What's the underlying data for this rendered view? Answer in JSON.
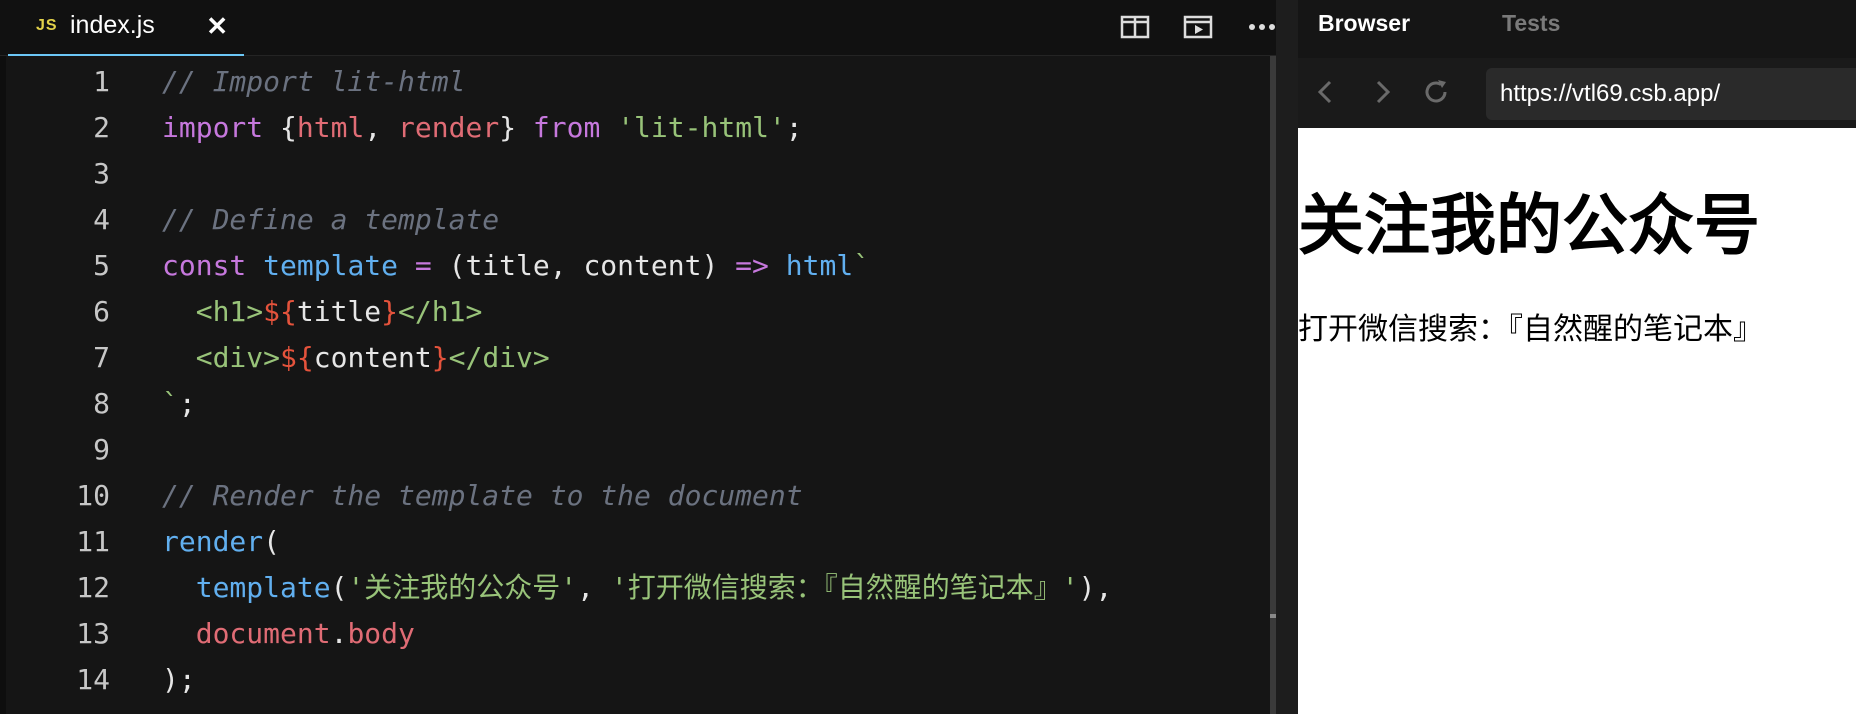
{
  "editor": {
    "tab": {
      "icon": "JS",
      "label": "index.js",
      "close_icon": "close-icon"
    },
    "toolbar_icons": [
      "split-view-icon",
      "preview-icon",
      "more-icon"
    ],
    "lines": [
      {
        "no": "1",
        "tokens": [
          {
            "t": "// Import lit-html",
            "c": "cm"
          }
        ]
      },
      {
        "no": "2",
        "tokens": [
          {
            "t": "import",
            "c": "kw"
          },
          {
            "t": " {",
            "c": "plain"
          },
          {
            "t": "html",
            "c": "id-red"
          },
          {
            "t": ", ",
            "c": "plain"
          },
          {
            "t": "render",
            "c": "id-red"
          },
          {
            "t": "} ",
            "c": "plain"
          },
          {
            "t": "from",
            "c": "kw"
          },
          {
            "t": " ",
            "c": "plain"
          },
          {
            "t": "'lit-html'",
            "c": "str"
          },
          {
            "t": ";",
            "c": "plain"
          }
        ]
      },
      {
        "no": "3",
        "tokens": []
      },
      {
        "no": "4",
        "tokens": [
          {
            "t": "// Define a template",
            "c": "cm"
          }
        ]
      },
      {
        "no": "5",
        "tokens": [
          {
            "t": "const",
            "c": "kw"
          },
          {
            "t": " ",
            "c": "plain"
          },
          {
            "t": "template",
            "c": "fn"
          },
          {
            "t": " = ",
            "c": "kw"
          },
          {
            "t": "(title, content) ",
            "c": "plain"
          },
          {
            "t": "=>",
            "c": "kw"
          },
          {
            "t": " ",
            "c": "plain"
          },
          {
            "t": "html",
            "c": "fn"
          },
          {
            "t": "`",
            "c": "str"
          }
        ]
      },
      {
        "no": "6",
        "tokens": [
          {
            "t": "  <h1>",
            "c": "str"
          },
          {
            "t": "${",
            "c": "tpl"
          },
          {
            "t": "title",
            "c": "plain"
          },
          {
            "t": "}",
            "c": "tpl"
          },
          {
            "t": "</h1>",
            "c": "str"
          }
        ]
      },
      {
        "no": "7",
        "tokens": [
          {
            "t": "  <div>",
            "c": "str"
          },
          {
            "t": "${",
            "c": "tpl"
          },
          {
            "t": "content",
            "c": "plain"
          },
          {
            "t": "}",
            "c": "tpl"
          },
          {
            "t": "</div>",
            "c": "str"
          }
        ]
      },
      {
        "no": "8",
        "tokens": [
          {
            "t": "`",
            "c": "str"
          },
          {
            "t": ";",
            "c": "plain"
          }
        ]
      },
      {
        "no": "9",
        "tokens": []
      },
      {
        "no": "10",
        "tokens": [
          {
            "t": "// Render the template to the document",
            "c": "cm"
          }
        ]
      },
      {
        "no": "11",
        "tokens": [
          {
            "t": "render",
            "c": "fn"
          },
          {
            "t": "(",
            "c": "plain"
          }
        ]
      },
      {
        "no": "12",
        "tokens": [
          {
            "t": "  ",
            "c": "plain"
          },
          {
            "t": "template",
            "c": "fn"
          },
          {
            "t": "(",
            "c": "plain"
          },
          {
            "t": "'关注我的公众号'",
            "c": "str"
          },
          {
            "t": ", ",
            "c": "plain"
          },
          {
            "t": "'打开微信搜索：『自然醒的笔记本』'",
            "c": "str"
          },
          {
            "t": "),",
            "c": "plain"
          }
        ]
      },
      {
        "no": "13",
        "tokens": [
          {
            "t": "  ",
            "c": "plain"
          },
          {
            "t": "document",
            "c": "id-red"
          },
          {
            "t": ".",
            "c": "plain"
          },
          {
            "t": "body",
            "c": "id-red"
          }
        ]
      },
      {
        "no": "14",
        "tokens": [
          {
            "t": ");",
            "c": "plain"
          }
        ]
      }
    ]
  },
  "browser": {
    "tabs": [
      {
        "label": "Browser",
        "active": true
      },
      {
        "label": "Tests",
        "active": false
      }
    ],
    "nav_icons": [
      "back-icon",
      "forward-icon",
      "refresh-icon"
    ],
    "url": "https://vtl69.csb.app/",
    "page": {
      "h1": "关注我的公众号",
      "div": "打开微信搜索：『自然醒的笔记本』"
    }
  },
  "colors": {
    "background": "#151515",
    "keyword": "#c678dd",
    "identifier": "#e06c75",
    "string": "#98c379",
    "function": "#61afef",
    "comment": "#6b7280",
    "template_delim": "#e5533c",
    "tab_underline": "#6cc7f6",
    "js_badge": "#e3d24a"
  }
}
